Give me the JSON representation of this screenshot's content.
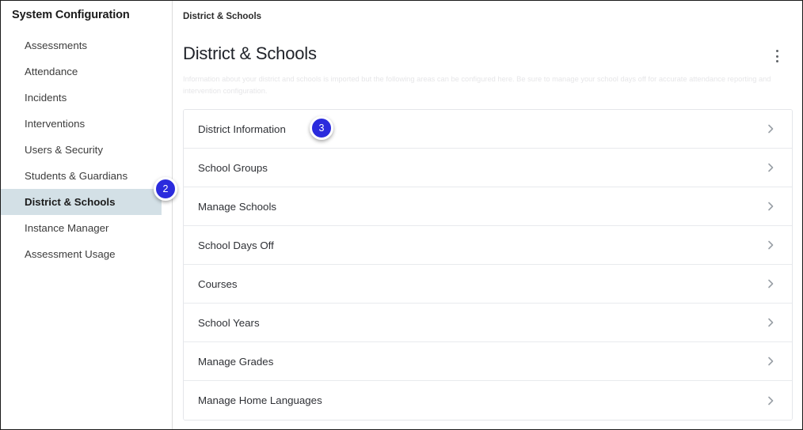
{
  "sidebar": {
    "title": "System Configuration",
    "items": [
      {
        "label": "Assessments",
        "selected": false
      },
      {
        "label": "Attendance",
        "selected": false
      },
      {
        "label": "Incidents",
        "selected": false
      },
      {
        "label": "Interventions",
        "selected": false
      },
      {
        "label": "Users & Security",
        "selected": false
      },
      {
        "label": "Students & Guardians",
        "selected": false
      },
      {
        "label": "District & Schools",
        "selected": true
      },
      {
        "label": "Instance Manager",
        "selected": false
      },
      {
        "label": "Assessment Usage",
        "selected": false
      }
    ],
    "selected_bg_color": "#d3e0e6"
  },
  "content": {
    "breadcrumb": "District & Schools",
    "page_title": "District & Schools",
    "description": "Information about your district and schools is imported but the following areas can be configured here. Be sure to manage your school days off for accurate attendance reporting and intervention configuration.",
    "overflow_menu_icon": "kebab-menu-icon",
    "list": [
      {
        "label": "District Information",
        "chevron": "chevron-right-icon"
      },
      {
        "label": "School Groups",
        "chevron": "chevron-right-icon"
      },
      {
        "label": "Manage Schools",
        "chevron": "chevron-right-icon"
      },
      {
        "label": "School Days Off",
        "chevron": "chevron-right-icon"
      },
      {
        "label": "Courses",
        "chevron": "chevron-right-icon"
      },
      {
        "label": "School Years",
        "chevron": "chevron-right-icon"
      },
      {
        "label": "Manage Grades",
        "chevron": "chevron-right-icon"
      },
      {
        "label": "Manage Home Languages",
        "chevron": "chevron-right-icon"
      }
    ]
  },
  "annotations": {
    "color": "#2b2bdd",
    "badges": [
      {
        "number": "2",
        "target": "sidebar-item-district-schools"
      },
      {
        "number": "3",
        "target": "list-item-district-information"
      }
    ]
  }
}
